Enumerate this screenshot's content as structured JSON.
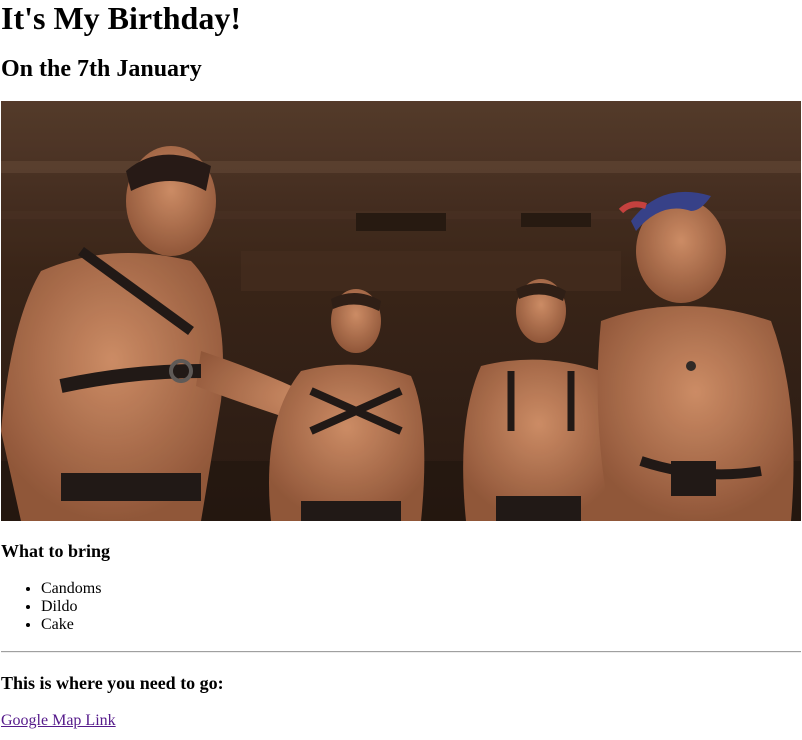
{
  "header": {
    "title": "It's My Birthday!",
    "date_line": "On the 7th January"
  },
  "photo": {
    "icon": "party-photo"
  },
  "bring": {
    "heading": "What to bring",
    "items": [
      "Candoms",
      "Dildo",
      "Cake"
    ]
  },
  "location": {
    "heading": "This is where you need to go:",
    "link_text": "Google Map Link"
  }
}
